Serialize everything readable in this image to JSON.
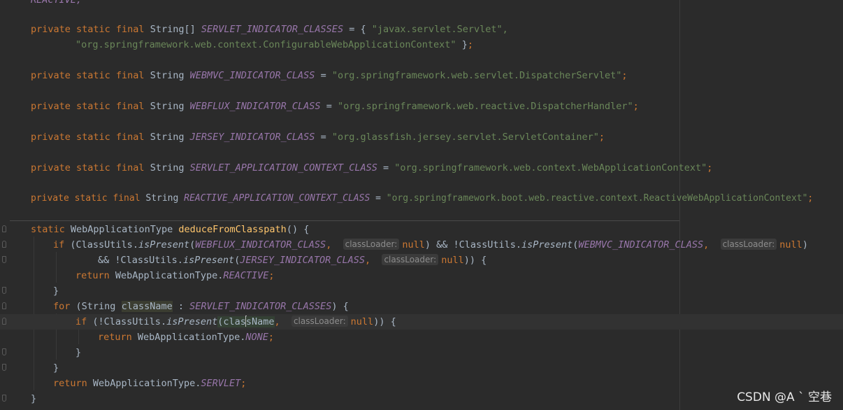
{
  "editor": {
    "language": "Java",
    "theme": "Darcula",
    "watermark": "CSDN @A ` 空巷"
  },
  "colors": {
    "background": "#2b2b2b",
    "keyword": "#cc7832",
    "constant": "#9876aa",
    "string": "#6a8759",
    "method": "#ffc66d",
    "text": "#a9b7c6"
  },
  "code": {
    "top_fragment": "REACTIVE;",
    "fields": [
      {
        "modifiers": "private static final",
        "type": "String[]",
        "name": "SERVLET_INDICATOR_CLASSES",
        "value": "\"javax.servlet.Servlet\",",
        "continuation": "\"org.springframework.web.context.ConfigurableWebApplicationContext\""
      },
      {
        "modifiers": "private static final",
        "type": "String",
        "name": "WEBMVC_INDICATOR_CLASS",
        "value": "\"org.springframework.web.servlet.DispatcherServlet\""
      },
      {
        "modifiers": "private static final",
        "type": "String",
        "name": "WEBFLUX_INDICATOR_CLASS",
        "value": "\"org.springframework.web.reactive.DispatcherHandler\""
      },
      {
        "modifiers": "private static final",
        "type": "String",
        "name": "JERSEY_INDICATOR_CLASS",
        "value": "\"org.glassfish.jersey.servlet.ServletContainer\""
      },
      {
        "modifiers": "private static final",
        "type": "String",
        "name": "SERVLET_APPLICATION_CONTEXT_CLASS",
        "value": "\"org.springframework.web.context.WebApplicationContext\""
      },
      {
        "modifiers": "private static final",
        "type": "String",
        "name": "REACTIVE_APPLICATION_CONTEXT_CLASS",
        "value": "\"org.springframework.boot.web.reactive.context.ReactiveWebApplicationContext\""
      }
    ],
    "method": {
      "modifier": "static",
      "return_type": "WebApplicationType",
      "name": "deduceFromClasspath",
      "class_utils": "ClassUtils",
      "is_present": "isPresent",
      "hint_label": "classLoader:",
      "null_kw": "null",
      "if_kw": "if",
      "for_kw": "for",
      "return_kw": "return",
      "string_type": "String",
      "loop_var": "className",
      "enum_type": "WebApplicationType",
      "enum_reactive": "REACTIVE",
      "enum_none": "NONE",
      "enum_servlet": "SERVLET"
    }
  }
}
